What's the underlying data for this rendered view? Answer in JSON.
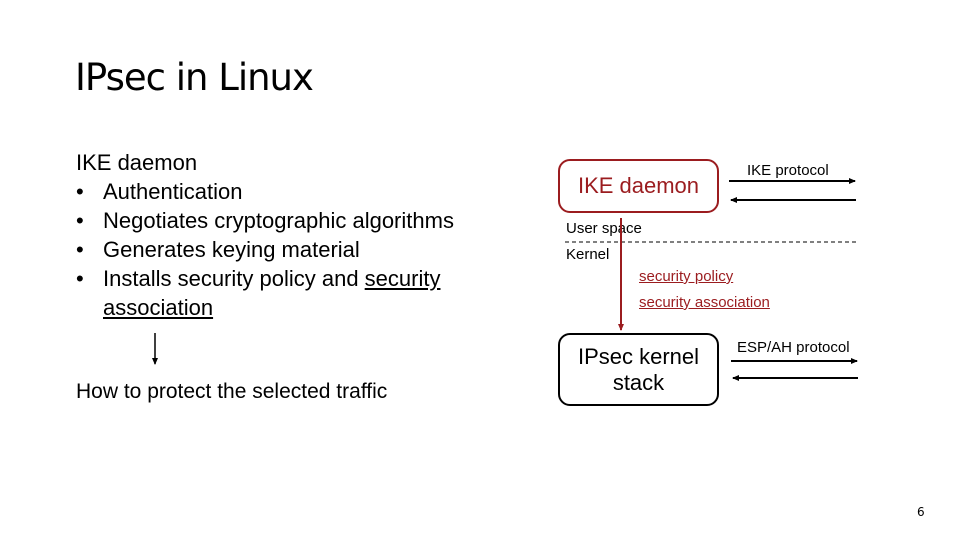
{
  "slide": {
    "title": "IPsec in Linux",
    "page_number": "6"
  },
  "left": {
    "heading": "IKE daemon",
    "bullet_char": "•",
    "bullets": [
      {
        "text": "Authentication"
      },
      {
        "text": "Negotiates cryptographic algorithms"
      },
      {
        "text": "Generates keying material"
      },
      {
        "text_plain": "Installs security policy and ",
        "text_underlined_1": "security",
        "text_underlined_2": "association"
      }
    ],
    "arrow_icon": "down-arrow-icon",
    "conclusion": "How to protect the selected traffic"
  },
  "diagram": {
    "ike_box_label": "IKE daemon",
    "ike_protocol_label": "IKE protocol",
    "user_space_label": "User space",
    "kernel_label": "Kernel",
    "security_policy_label": "security policy",
    "security_association_label": "security association",
    "ipsec_box_line1": "IPsec kernel",
    "ipsec_box_line2": "stack",
    "esp_ah_label": "ESP/AH protocol",
    "colors": {
      "accent_red": "#9b1c1f",
      "line_black": "#000000"
    }
  }
}
